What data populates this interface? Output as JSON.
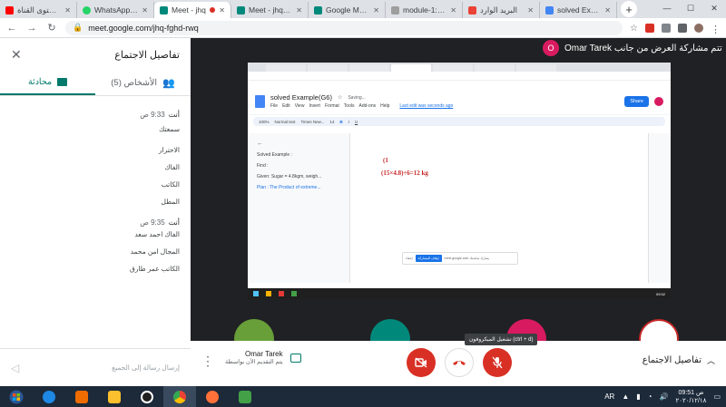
{
  "browser": {
    "tabs": [
      {
        "title": "محتوى القناة - dio",
        "color": "#ff0000"
      },
      {
        "title": "WhatsApp (29)",
        "color": "#25d366"
      },
      {
        "title": "Meet - jhq",
        "color": "#00897b",
        "active": true
      },
      {
        "title": "Meet - jhq-fgh",
        "color": "#00897b"
      },
      {
        "title": "Google Meet",
        "color": "#00897b"
      },
      {
        "title": "module-1: Exa",
        "color": "#9e9e9e"
      },
      {
        "title": "البريد الوارد",
        "color": "#ea4335"
      },
      {
        "title": "solved Exampl",
        "color": "#4285f4"
      }
    ],
    "url": "meet.google.com/jhq-fghd-rwq"
  },
  "panel": {
    "title": "تفاصيل الاجتماع",
    "tab_chat": "محادثة",
    "tab_people": "الأشخاص (5)",
    "messages": [
      {
        "sender": "أنت",
        "time": "9:33 ص",
        "lines": [
          "سمعتك",
          "الاحترار",
          "الفاك",
          "الكاتب",
          "المطل"
        ]
      },
      {
        "sender": "أنت",
        "time": "9:35 ص",
        "lines": [
          "الفاك احمد سعد",
          "المجال امن محمد",
          "الكاتب عمر طارق"
        ]
      }
    ],
    "send_placeholder": "إرسال رسالة إلى الجميع"
  },
  "stage": {
    "presenter_label": "تتم مشاركة العرض من جانب Omar Tarek",
    "presenter_initial": "O"
  },
  "shared_screen": {
    "doc_title": "solved Example(G6)",
    "saving": "Saving...",
    "menu": [
      "File",
      "Edit",
      "View",
      "Insert",
      "Format",
      "Tools",
      "Add-ons",
      "Help"
    ],
    "last_edit": "Last edit was seconds ago",
    "share_label": "Share",
    "toolbar_zoom": "100%",
    "toolbar_style": "Normal text",
    "toolbar_font": "Times New...",
    "toolbar_size": "14",
    "outline": [
      "Solved Example :",
      "Find :",
      "Given: Sugar = 4.8kgm, weigh...",
      "Plan : The Product of extreme..."
    ],
    "math_1": "(1",
    "math_2": "(15×4.8)÷6=12 kg",
    "share_bar_text": "meet.google.com يشارك شاشتك",
    "share_bar_stop": "إيقاف المشاركة",
    "share_bar_hide": "إخفاء",
    "taskbar_time": "09:52"
  },
  "bottombar": {
    "meeting_details": "تفاصيل الاجتماع",
    "presenting_name": "Omar Tarek",
    "presenting_sub": "يتم التقديم الآن بواسطة",
    "tooltip": "تشغيل الميكروفون (ctrl + d)"
  },
  "taskbar": {
    "lang": "AR",
    "time": "09:51 ص",
    "date": "٢٠٢٠/١٢/١٨"
  },
  "colors": {
    "meet_teal": "#00796b",
    "end_red": "#d93025",
    "presenter_pink": "#d81b60"
  }
}
